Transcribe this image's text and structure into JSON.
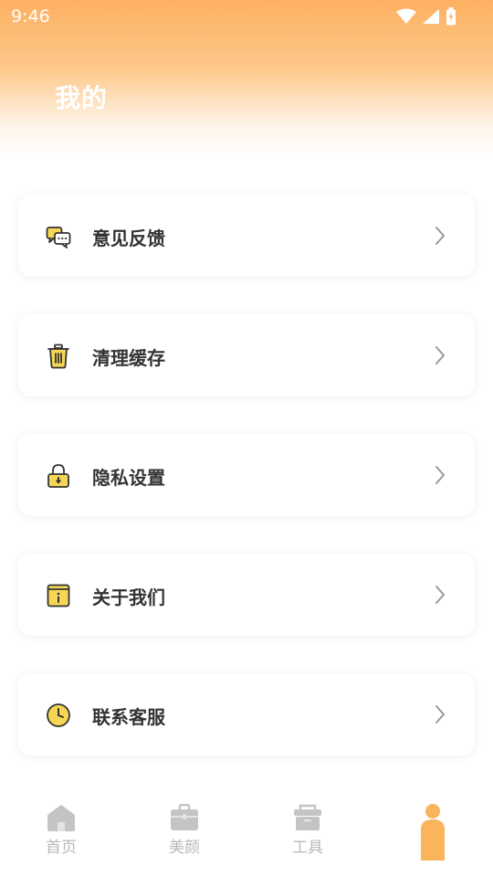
{
  "status_bar": {
    "time": "9:46"
  },
  "page": {
    "title": "我的"
  },
  "menu": [
    {
      "label": "意见反馈",
      "icon": "chat-bubbles-icon"
    },
    {
      "label": "清理缓存",
      "icon": "trash-icon"
    },
    {
      "label": "隐私设置",
      "icon": "lock-icon"
    },
    {
      "label": "关于我们",
      "icon": "info-icon"
    },
    {
      "label": "联系客服",
      "icon": "clock-icon"
    }
  ],
  "tabs": [
    {
      "label": "首页",
      "icon": "home-icon"
    },
    {
      "label": "美颜",
      "icon": "briefcase-icon"
    },
    {
      "label": "工具",
      "icon": "toolbox-icon"
    },
    {
      "label": "",
      "icon": "person-icon",
      "active": true
    }
  ],
  "colors": {
    "accent": "#fdb061",
    "icon_yellow": "#f7d655",
    "text": "#333333",
    "tab_inactive": "#c4c4c4"
  }
}
